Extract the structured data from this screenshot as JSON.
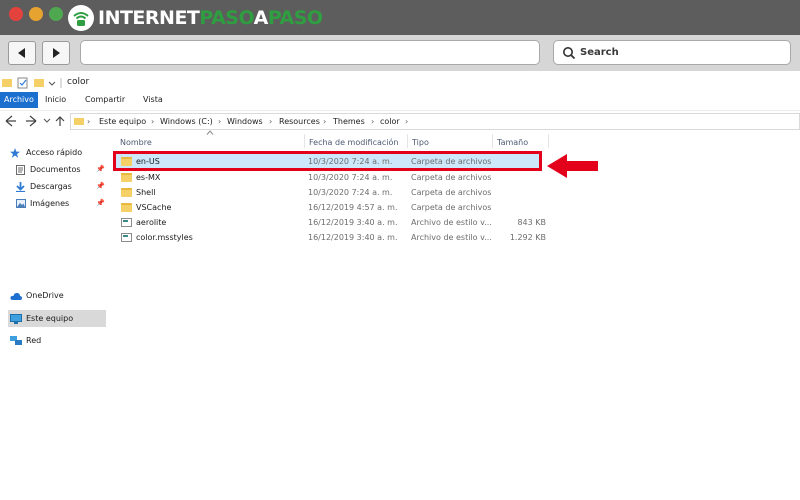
{
  "colors": {
    "topbar": "#5d5d5d",
    "close": "#e4433d",
    "minimize": "#e7a32f",
    "zoom": "#4fa84f",
    "brand_green": "#2f9e41",
    "selection": "#cde8fa",
    "annotation_red": "#e2001a",
    "ribbon_active": "#1a6fcf"
  },
  "site_logo": {
    "part1": "INTERNET",
    "part2": "PASO",
    "part3": "A",
    "part4": "PASO",
    "icon": "wifi-thumbs-up-icon"
  },
  "browser": {
    "search_label": "Search",
    "back_icon": "back-arrow-icon",
    "forward_icon": "forward-arrow-icon"
  },
  "window": {
    "title": "color"
  },
  "ribbon": {
    "tabs": [
      "Archivo",
      "Inicio",
      "Compartir",
      "Vista"
    ],
    "active": "Archivo"
  },
  "address": {
    "crumbs": [
      "Este equipo",
      "Windows (C:)",
      "Windows",
      "Resources",
      "Themes",
      "color"
    ]
  },
  "nav_pane": {
    "quick_access": "Acceso rápido",
    "items": [
      {
        "label": "Documentos",
        "icon": "documents-icon",
        "pinned": true
      },
      {
        "label": "Descargas",
        "icon": "downloads-icon",
        "pinned": true
      },
      {
        "label": "Imágenes",
        "icon": "pictures-icon",
        "pinned": true
      }
    ],
    "onedrive": "OneDrive",
    "this_pc": "Este equipo",
    "network": "Red"
  },
  "columns": [
    "Nombre",
    "Fecha de modificación",
    "Tipo",
    "Tamaño"
  ],
  "files": [
    {
      "name": "en-US",
      "date": "10/3/2020 7:24 a. m.",
      "type": "Carpeta de archivos",
      "size": "",
      "kind": "folder",
      "selected": true
    },
    {
      "name": "es-MX",
      "date": "10/3/2020 7:24 a. m.",
      "type": "Carpeta de archivos",
      "size": "",
      "kind": "folder"
    },
    {
      "name": "Shell",
      "date": "10/3/2020 7:24 a. m.",
      "type": "Carpeta de archivos",
      "size": "",
      "kind": "folder"
    },
    {
      "name": "VSCache",
      "date": "16/12/2019 4:57 a. m.",
      "type": "Carpeta de archivos",
      "size": "",
      "kind": "folder"
    },
    {
      "name": "aerolite",
      "date": "16/12/2019 3:40 a. m.",
      "type": "Archivo de estilo v...",
      "size": "843 KB",
      "kind": "file"
    },
    {
      "name": "color.msstyles",
      "date": "16/12/2019 3:40 a. m.",
      "type": "Archivo de estilo v...",
      "size": "1.292 KB",
      "kind": "file"
    }
  ]
}
